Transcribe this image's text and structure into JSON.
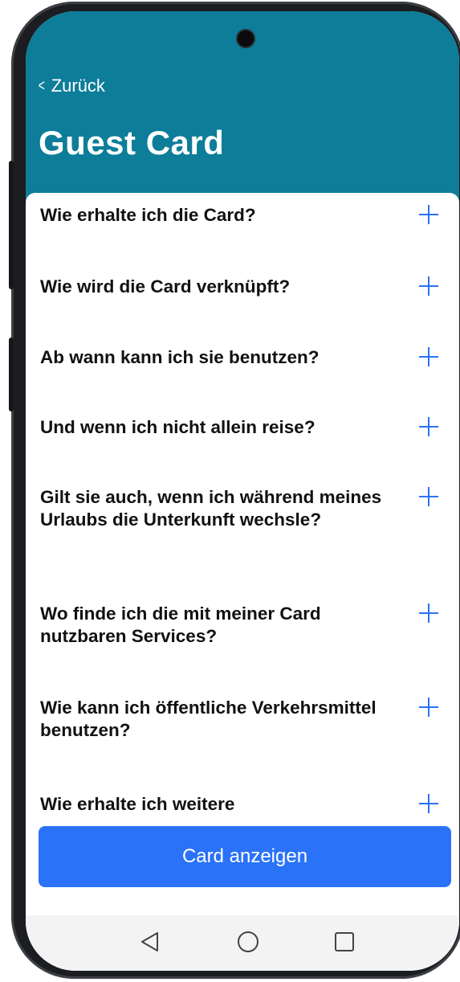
{
  "header": {
    "back_label": "Zurück",
    "title": "Guest Card",
    "background_color": "#0d7d99"
  },
  "faq": {
    "items": [
      {
        "question": "Wie erhalte ich die Card?"
      },
      {
        "question": "Wie wird die Card verknüpft?"
      },
      {
        "question": "Ab wann kann ich sie benutzen?"
      },
      {
        "question": "Und wenn ich nicht allein reise?"
      },
      {
        "question": "Gilt sie auch, wenn ich während meines Urlaubs die Unterkunft wechsle?"
      },
      {
        "question": "Wo finde ich die mit meiner Card nutzbaren Services?"
      },
      {
        "question": "Wie kann ich öffentliche Verkehrsmittel benutzen?"
      },
      {
        "question": "Wie erhalte ich weitere"
      }
    ],
    "expand_icon": "plus-icon",
    "accent_color": "#2a73f5"
  },
  "cta": {
    "label": "Card anzeigen",
    "color": "#2a72f7"
  },
  "system_nav": {
    "back_icon": "triangle-back-icon",
    "home_icon": "circle-home-icon",
    "recents_icon": "square-recents-icon"
  }
}
